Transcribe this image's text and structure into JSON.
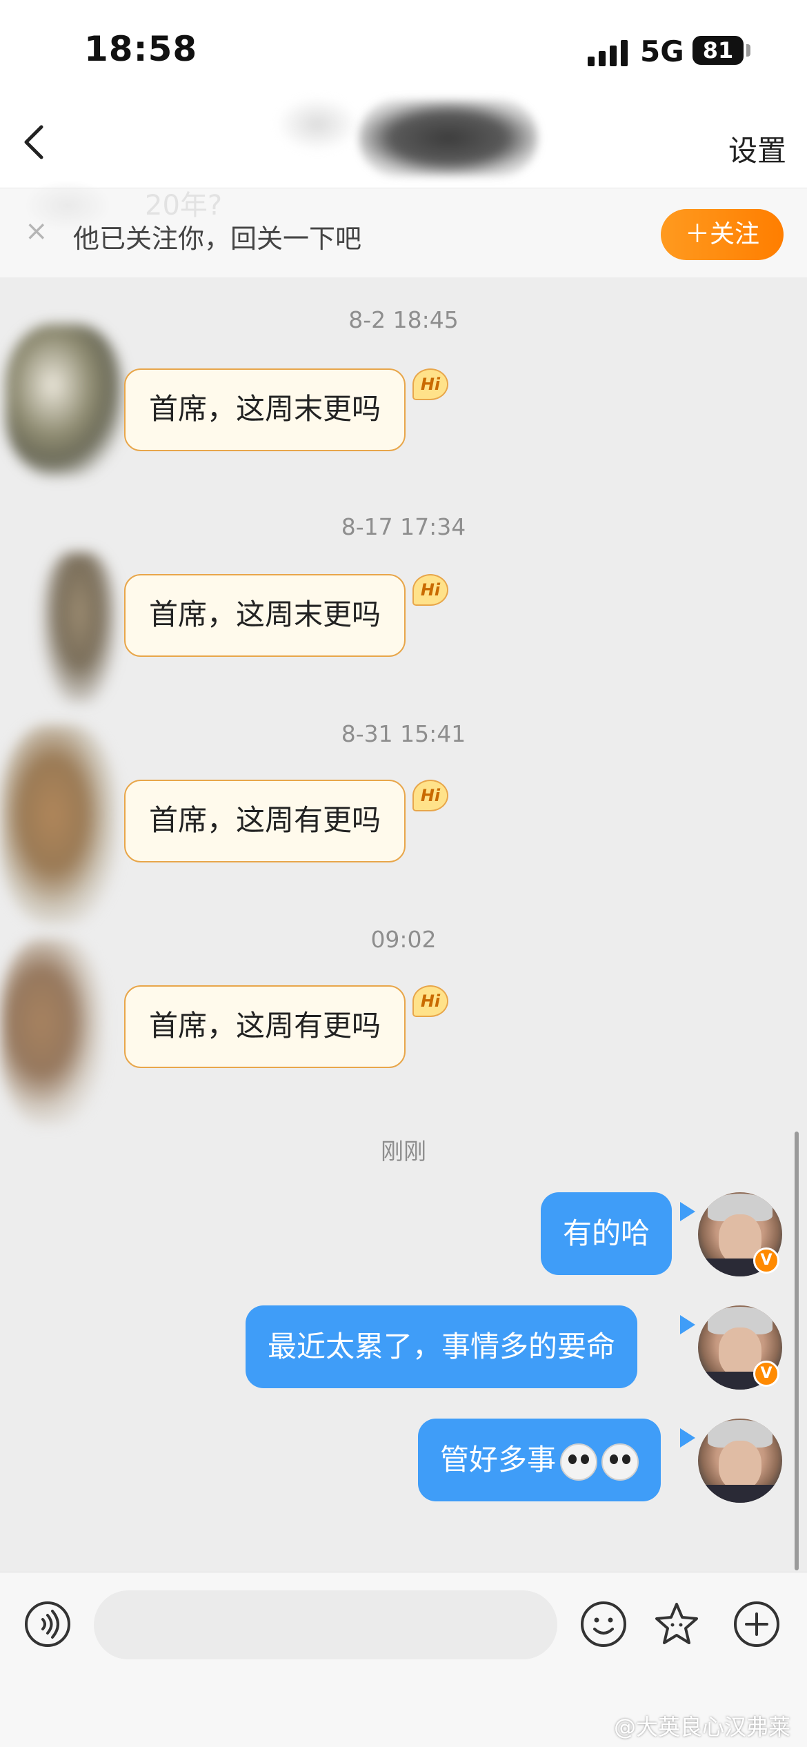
{
  "status_bar": {
    "time": "18:58",
    "network": "5G",
    "battery": "81"
  },
  "nav": {
    "settings_label": "设置"
  },
  "follow_banner": {
    "ghost_text": "20年?",
    "close_icon": "×",
    "text": "他已关注你，回关一下吧",
    "button_label": "＋关注"
  },
  "messages": [
    {
      "timestamp": "8-2 18:45",
      "text": "首席，这周末更吗",
      "badge": "Hi"
    },
    {
      "timestamp": "8-17 17:34",
      "text": "首席，这周末更吗",
      "badge": "Hi"
    },
    {
      "timestamp": "8-31 15:41",
      "text": "首席，这周有更吗",
      "badge": "Hi"
    },
    {
      "timestamp": "09:02",
      "text": "首席，这周有更吗",
      "badge": "Hi"
    }
  ],
  "recent_label": "刚刚",
  "my_messages": [
    {
      "text": "有的哈",
      "verified": "V"
    },
    {
      "text": "最近太累了，事情多的要命",
      "verified": "V"
    },
    {
      "text": "管好多事",
      "emoji": "husky-emoji"
    }
  ],
  "toolbar": {
    "voice_icon": "voice-icon",
    "emoji_icon": "smile-icon",
    "sticker_icon": "star-icon",
    "more_icon": "plus-icon"
  },
  "watermark": "@大英良心汉弗莱",
  "colors": {
    "accent_blue": "#3f9df8",
    "follow_orange": "#ff8a00",
    "incoming_border": "#e8a64a"
  }
}
